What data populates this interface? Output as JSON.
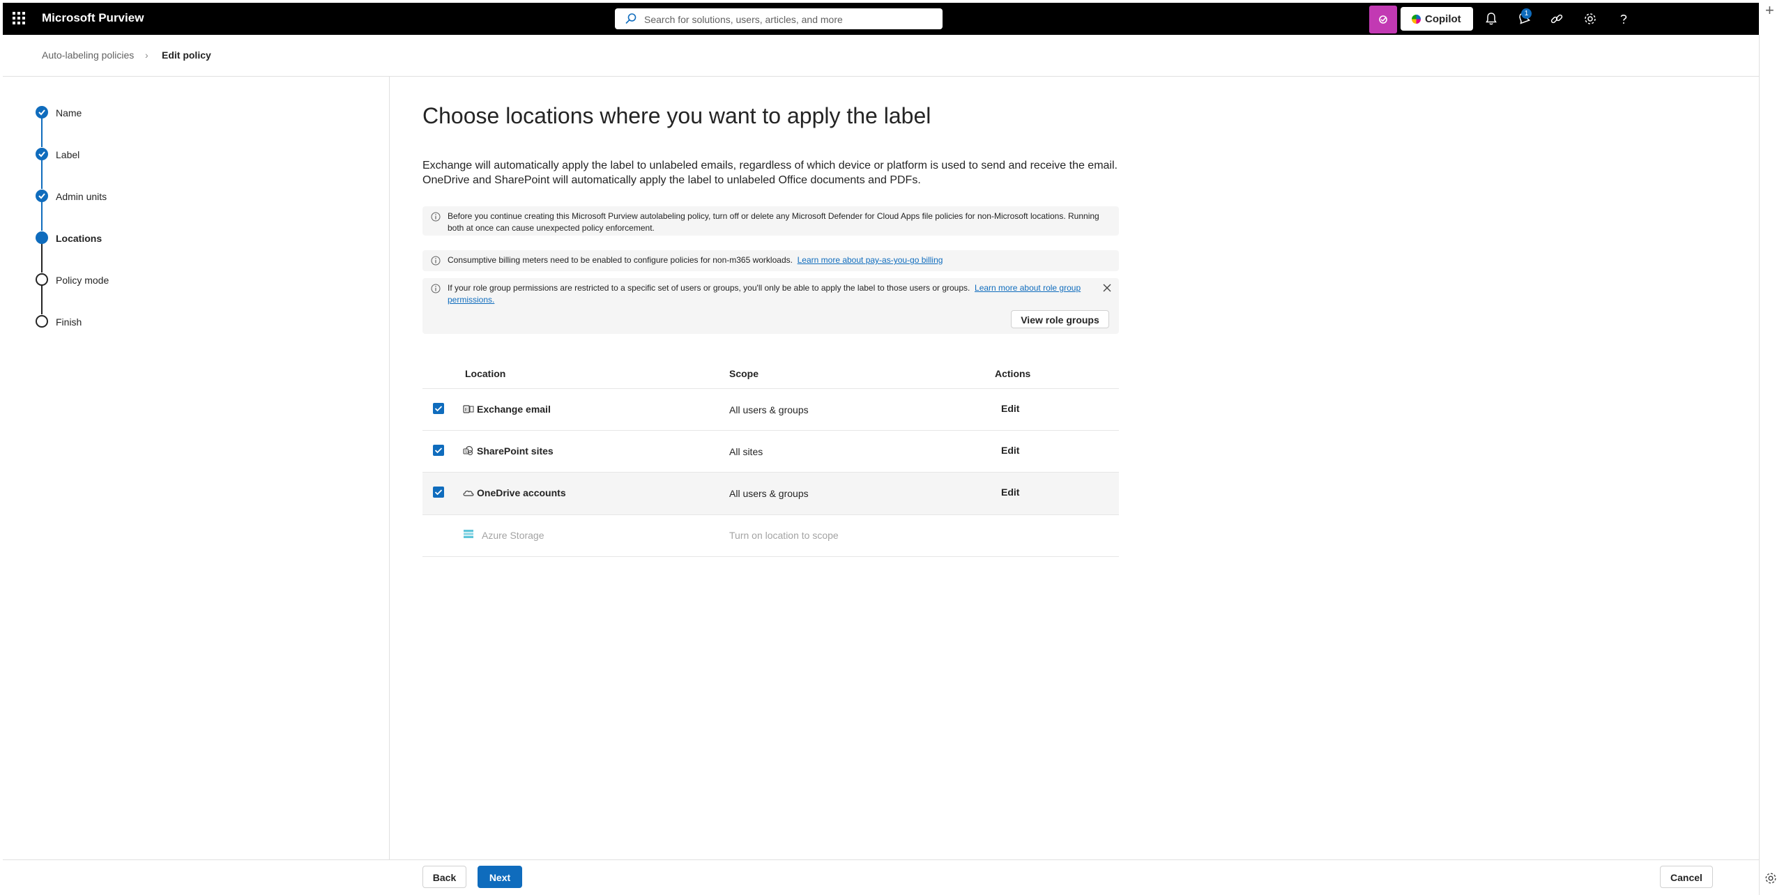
{
  "topbar": {
    "app_title": "Microsoft Purview",
    "search_placeholder": "Search for solutions, users, articles, and more",
    "copilot_label": "Copilot",
    "notification_count": "1",
    "icons": [
      "waffle-icon",
      "search-icon",
      "copilot-app-icon",
      "bell-icon",
      "bell-rocket-icon",
      "link-icon",
      "gear-icon",
      "help-icon"
    ]
  },
  "breadcrumb": {
    "parent": "Auto-labeling policies",
    "current": "Edit policy"
  },
  "steps": [
    {
      "label": "Name",
      "state": "done"
    },
    {
      "label": "Label",
      "state": "done"
    },
    {
      "label": "Admin units",
      "state": "done"
    },
    {
      "label": "Locations",
      "state": "current"
    },
    {
      "label": "Policy mode",
      "state": "todo"
    },
    {
      "label": "Finish",
      "state": "todo"
    }
  ],
  "main": {
    "title": "Choose locations where you want to apply the label",
    "description_line1": "Exchange will automatically apply the label to unlabeled emails, regardless of which device or platform is used to send and receive the email.",
    "description_line2": "OneDrive and SharePoint will automatically apply the label to unlabeled Office documents and PDFs.",
    "notice1": "Before you continue creating this Microsoft Purview autolabeling policy, turn off or delete any Microsoft Defender for Cloud Apps file policies for non-Microsoft locations. Running both at once can cause unexpected policy enforcement.",
    "notice2_text": "Consumptive billing meters need to be enabled to configure policies for non-m365 workloads.",
    "notice2_link": "Learn more about pay-as-you-go billing",
    "notice3_text": "If your role group permissions are restricted to a specific set of users or groups, you'll only be able to apply the label to those users or groups.",
    "notice3_link": "Learn more about role group permissions.",
    "view_role_groups": "View role groups"
  },
  "table": {
    "headers": {
      "location": "Location",
      "scope": "Scope",
      "actions": "Actions"
    },
    "rows": [
      {
        "name": "Exchange email",
        "scope": "All users & groups",
        "action": "Edit",
        "checked": true,
        "icon": "exchange-icon"
      },
      {
        "name": "SharePoint sites",
        "scope": "All sites",
        "action": "Edit",
        "checked": true,
        "icon": "sharepoint-icon"
      },
      {
        "name": "OneDrive accounts",
        "scope": "All users & groups",
        "action": "Edit",
        "checked": true,
        "icon": "onedrive-icon"
      },
      {
        "name": "Azure Storage",
        "scope": "Turn on location to scope",
        "action": "",
        "checked": false,
        "icon": "azure-storage-icon"
      }
    ]
  },
  "footer": {
    "back": "Back",
    "next": "Next",
    "cancel": "Cancel"
  },
  "colors": {
    "topbar": "#000000",
    "accent": "#0f6cbd",
    "copilot_square": "#c239b3"
  }
}
